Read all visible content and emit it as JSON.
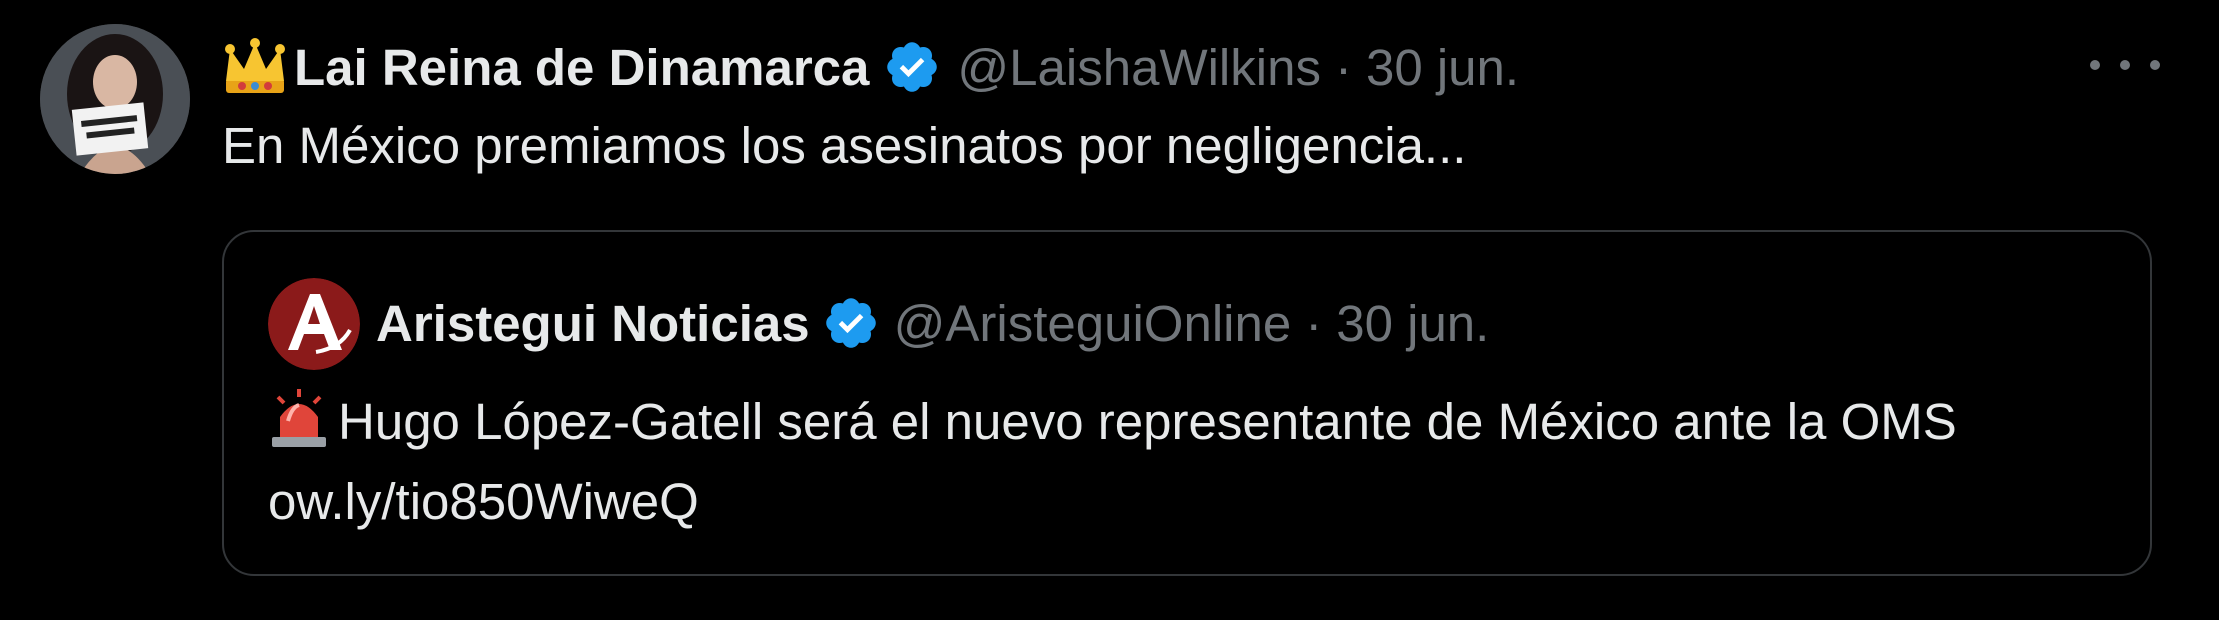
{
  "tweet": {
    "author_name": "Lai Reina de Dinamarca",
    "author_handle": "@LaishaWilkins",
    "separator": "·",
    "date": "30 jun.",
    "text": "En México premiamos los asesinatos por negligencia...",
    "icons": [
      "crown-emoji",
      "verified-badge-icon",
      "more-options-icon"
    ]
  },
  "quote": {
    "author_name": "Aristegui Noticias",
    "author_handle": "@AristeguiOnline",
    "separator": "·",
    "date": "30 jun.",
    "text": "Hugo López-Gatell será el nuevo representante de México ante la OMS ow.ly/tio850WiweQ",
    "icons": [
      "aristegui-logo",
      "verified-badge-icon",
      "siren-emoji"
    ]
  },
  "colors": {
    "background": "#000000",
    "text": "#e7e9ea",
    "secondary": "#71767b",
    "border": "#333639",
    "verified": "#1d9bf0",
    "logo_red": "#8b1a1a"
  }
}
